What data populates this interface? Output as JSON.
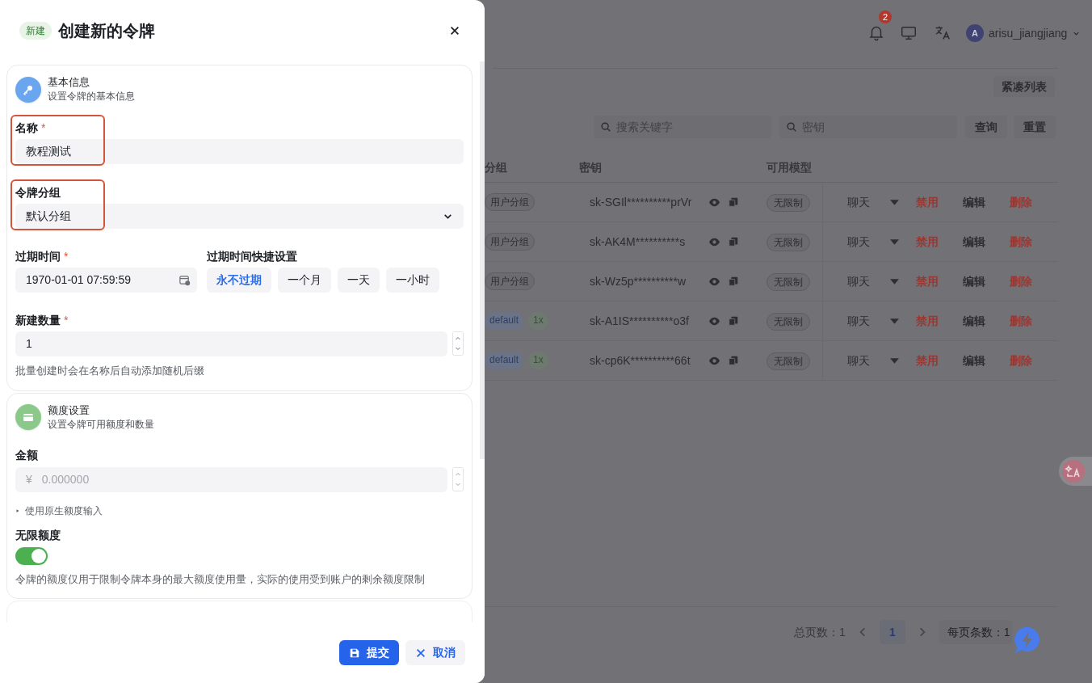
{
  "header": {
    "notification_count": "2",
    "avatar_letter": "A",
    "username": "arisu_jiangjiang"
  },
  "toolbar": {
    "compact_button": "紧凑列表",
    "search_fields": [
      {
        "placeholder": "搜索关键字"
      },
      {
        "placeholder": "密钥"
      }
    ],
    "buttons": [
      "查询",
      "重置"
    ]
  },
  "table": {
    "columns": [
      "分组",
      "密钥",
      "可用模型"
    ],
    "rows": [
      {
        "tags": [
          {
            "label": "用户分组",
            "kind": "plain"
          }
        ],
        "key": "sk-SGIl**********prVr",
        "models": "无限制",
        "actions": [
          {
            "label": "聊天",
            "kind": "menu"
          },
          {
            "label": "禁用",
            "kind": "danger"
          },
          {
            "label": "编辑",
            "kind": "plain"
          },
          {
            "label": "删除",
            "kind": "danger"
          }
        ]
      },
      {
        "tags": [
          {
            "label": "用户分组",
            "kind": "plain"
          }
        ],
        "key": "sk-AK4M**********s",
        "models": "无限制",
        "actions": [
          {
            "label": "聊天",
            "kind": "menu"
          },
          {
            "label": "禁用",
            "kind": "danger"
          },
          {
            "label": "编辑",
            "kind": "plain"
          },
          {
            "label": "删除",
            "kind": "danger"
          }
        ]
      },
      {
        "tags": [
          {
            "label": "用户分组",
            "kind": "plain"
          }
        ],
        "key": "sk-Wz5p**********w",
        "models": "无限制",
        "actions": [
          {
            "label": "聊天",
            "kind": "menu"
          },
          {
            "label": "禁用",
            "kind": "danger"
          },
          {
            "label": "编辑",
            "kind": "plain"
          },
          {
            "label": "删除",
            "kind": "danger"
          }
        ]
      },
      {
        "tags": [
          {
            "label": "default",
            "kind": "blue"
          },
          {
            "label": "1x",
            "kind": "green"
          }
        ],
        "key": "sk-A1IS**********o3f",
        "models": "无限制",
        "actions": [
          {
            "label": "聊天",
            "kind": "menu"
          },
          {
            "label": "禁用",
            "kind": "danger"
          },
          {
            "label": "编辑",
            "kind": "plain"
          },
          {
            "label": "删除",
            "kind": "danger"
          }
        ]
      },
      {
        "tags": [
          {
            "label": "default",
            "kind": "blue"
          },
          {
            "label": "1x",
            "kind": "green"
          }
        ],
        "key": "sk-cp6K**********66t",
        "models": "无限制",
        "actions": [
          {
            "label": "聊天",
            "kind": "menu"
          },
          {
            "label": "禁用",
            "kind": "danger"
          },
          {
            "label": "编辑",
            "kind": "plain"
          },
          {
            "label": "删除",
            "kind": "danger"
          }
        ]
      }
    ]
  },
  "pagination": {
    "total": "总页数：1",
    "pages": [
      {
        "label": "1",
        "selected": true
      }
    ],
    "page_size": "每页条数：1"
  },
  "drawer": {
    "badge": "新建",
    "title": "创建新的令牌",
    "basic_section": {
      "title": "基本信息",
      "subtitle": "设置令牌的基本信息",
      "name": {
        "label": "名称",
        "required_mark": "*",
        "value": "教程测试",
        "highlighted": true
      },
      "group": {
        "label": "令牌分组",
        "value": "默认分组",
        "highlighted": true
      },
      "expiry": {
        "label": "过期时间",
        "required_mark": "*",
        "value": "1970-01-01 07:59:59"
      },
      "quick_expiry": {
        "label": "过期时间快捷设置",
        "options": [
          {
            "label": "永不过期",
            "selected": true
          },
          {
            "label": "一个月",
            "selected": false
          },
          {
            "label": "一天",
            "selected": false
          },
          {
            "label": "一小时",
            "selected": false
          }
        ]
      },
      "count": {
        "label": "新建数量",
        "required_mark": "*",
        "value": "1",
        "hint": "批量创建时会在名称后自动添加随机后缀"
      }
    },
    "quota_section": {
      "title": "额度设置",
      "subtitle": "设置令牌可用额度和数量",
      "amount": {
        "label": "金额",
        "prefix": "¥",
        "placeholder": "0.000000"
      },
      "raw_input_toggle": {
        "label": "使用原生额度输入",
        "expanded": false
      },
      "unlimited": {
        "label": "无限额度",
        "on": true,
        "hint": "令牌的额度仅用于限制令牌本身的最大额度使用量，实际的使用受到账户的剩余额度限制"
      }
    },
    "buttons": [
      {
        "label": "提交",
        "kind": "primary"
      },
      {
        "label": "取消",
        "kind": "secondary"
      }
    ]
  }
}
